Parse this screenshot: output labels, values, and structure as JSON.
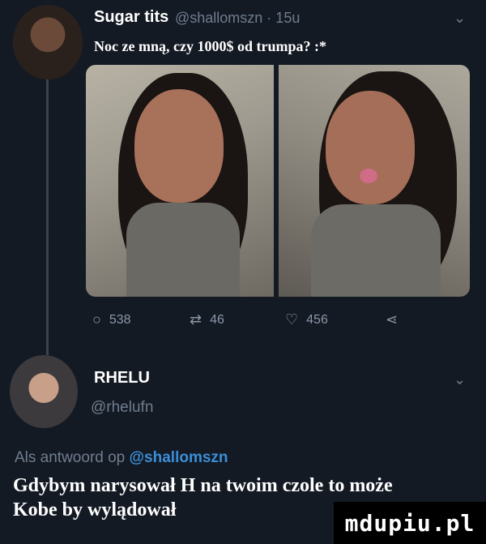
{
  "tweet": {
    "author_name": "Sugar tits",
    "author_handle": "@shallomszn · 15u",
    "text": "Noc ze mną, czy 1000$ od trumpa? :*",
    "actions": {
      "reply_count": "538",
      "retweet_count": "46",
      "like_count": "456"
    }
  },
  "reply": {
    "author_name": "RHELU",
    "author_handle": "@rhelufn",
    "reply_to_prefix": "Als antwoord op",
    "reply_to_handle": "@shallomszn"
  },
  "caption": {
    "line1": "Gdybym narysował H na twoim czole to może",
    "line2": "Kobe by wylądował"
  },
  "watermark": "mdupiu.pl",
  "icons": {
    "reply": "reply-icon",
    "retweet": "retweet-icon",
    "like": "heart-icon",
    "share": "share-icon",
    "more": "chevron-down-icon"
  },
  "colors": {
    "background": "#141a24",
    "handle": "#6f7d8e",
    "mention": "#3b8fd8"
  }
}
